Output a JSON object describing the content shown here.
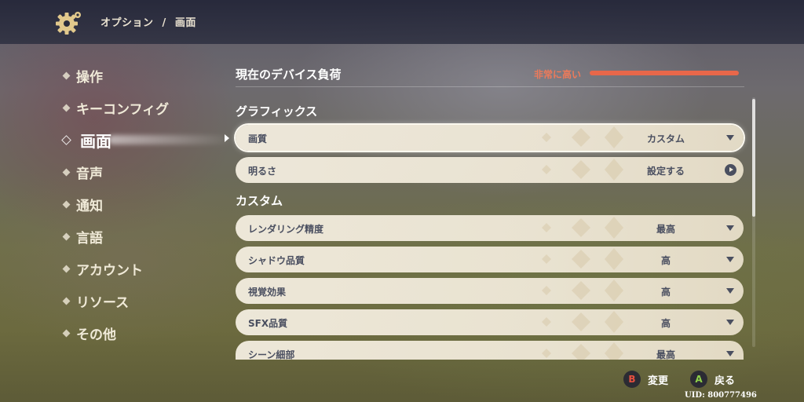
{
  "breadcrumb": {
    "section": "オプション",
    "separator": "/",
    "page": "画面"
  },
  "sidebar": {
    "items": [
      {
        "label": "操作",
        "active": false
      },
      {
        "label": "キーコンフィグ",
        "active": false
      },
      {
        "label": "画面",
        "active": true
      },
      {
        "label": "音声",
        "active": false
      },
      {
        "label": "通知",
        "active": false
      },
      {
        "label": "言語",
        "active": false
      },
      {
        "label": "アカウント",
        "active": false
      },
      {
        "label": "リソース",
        "active": false
      },
      {
        "label": "その他",
        "active": false
      }
    ]
  },
  "device_load": {
    "title": "現在のデバイス負荷",
    "status": "非常に高い",
    "status_color": "#e8674a"
  },
  "sections": {
    "graphics": "グラフィックス",
    "custom": "カスタム"
  },
  "graphics_rows": [
    {
      "label": "画質",
      "value": "カスタム",
      "control": "dropdown"
    },
    {
      "label": "明るさ",
      "value": "設定する",
      "control": "open"
    }
  ],
  "custom_rows": [
    {
      "label": "レンダリング精度",
      "value": "最高",
      "control": "dropdown"
    },
    {
      "label": "シャドウ品質",
      "value": "高",
      "control": "dropdown"
    },
    {
      "label": "視覚効果",
      "value": "高",
      "control": "dropdown"
    },
    {
      "label": "SFX品質",
      "value": "高",
      "control": "dropdown"
    },
    {
      "label": "シーン細部",
      "value": "最高",
      "control": "dropdown"
    }
  ],
  "footer": {
    "change": {
      "key": "B",
      "label": "変更",
      "key_color": "#e8503f"
    },
    "back": {
      "key": "A",
      "label": "戻る",
      "key_color": "#8fd14a"
    },
    "uid": "UID: 800777496"
  },
  "icons": {
    "settings": "gear-icon",
    "nav_bullet": "diamond-icon",
    "dropdown": "triangle-down-icon",
    "open": "circle-arrow-right-icon"
  }
}
